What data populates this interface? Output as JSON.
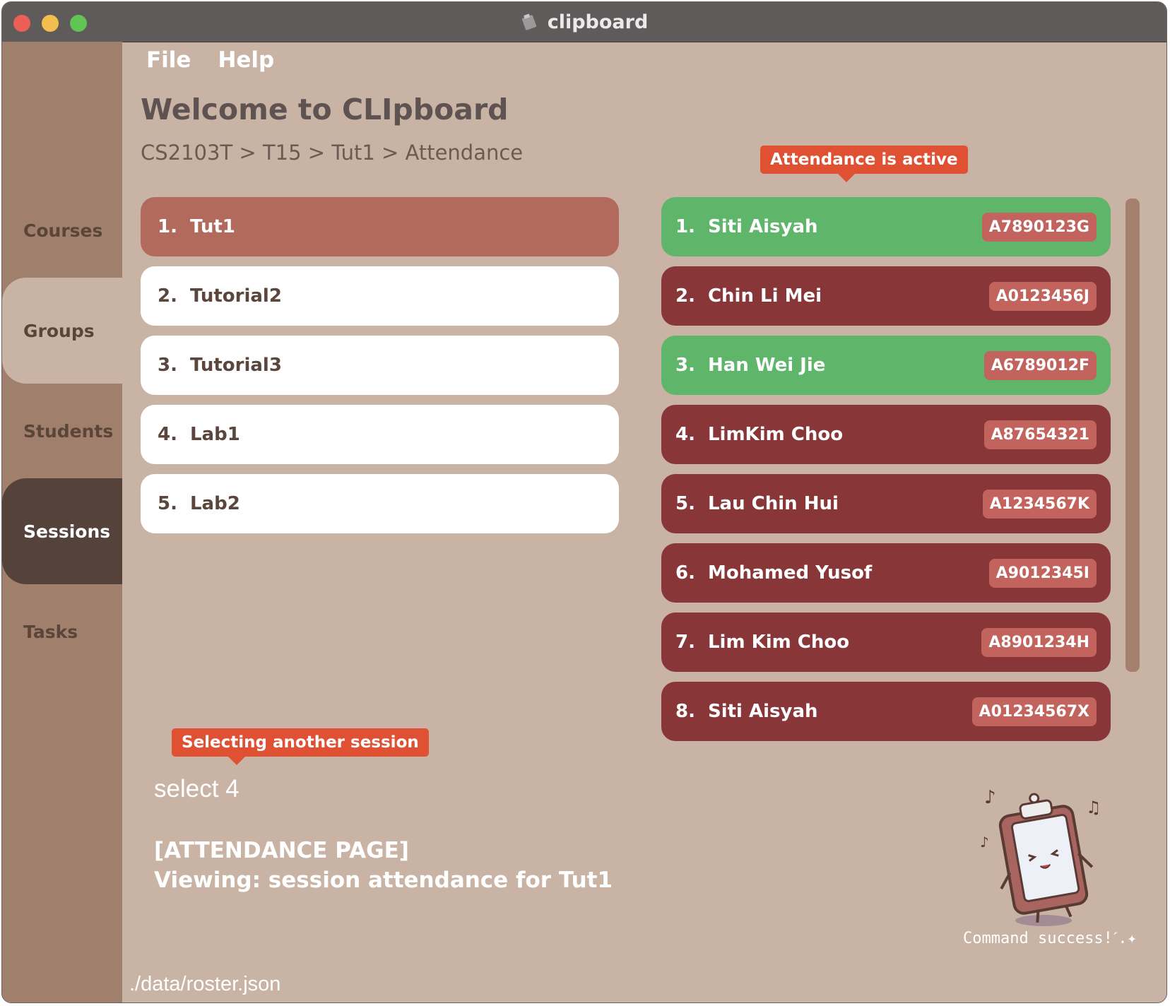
{
  "window": {
    "title": "clipboard",
    "title_icon": "clipboard-icon"
  },
  "menu": {
    "file": "File",
    "help": "Help"
  },
  "sidebar": {
    "items": [
      {
        "label": "Courses"
      },
      {
        "label": "Groups"
      },
      {
        "label": "Students"
      },
      {
        "label": "Sessions"
      },
      {
        "label": "Tasks"
      }
    ],
    "active": "Sessions"
  },
  "header": {
    "title": "Welcome to CLIpboard",
    "breadcrumb": "CS2103T > T15 > Tut1 > Attendance"
  },
  "callouts": {
    "attendance": "Attendance is active",
    "selecting": "Selecting another session"
  },
  "sessions": [
    {
      "index": "1.",
      "name": "Tut1",
      "active": true
    },
    {
      "index": "2.",
      "name": "Tutorial2"
    },
    {
      "index": "3.",
      "name": "Tutorial3"
    },
    {
      "index": "4.",
      "name": "Lab1"
    },
    {
      "index": "5.",
      "name": "Lab2"
    }
  ],
  "students": [
    {
      "index": "1.",
      "name": "Siti Aisyah",
      "id": "A7890123G",
      "present": true
    },
    {
      "index": "2.",
      "name": "Chin Li Mei",
      "id": "A0123456J",
      "present": false
    },
    {
      "index": "3.",
      "name": "Han Wei Jie",
      "id": "A6789012F",
      "present": true
    },
    {
      "index": "4.",
      "name": "LimKim Choo",
      "id": "A87654321",
      "present": false
    },
    {
      "index": "5.",
      "name": "Lau Chin Hui",
      "id": "A1234567K",
      "present": false
    },
    {
      "index": "6.",
      "name": "Mohamed Yusof",
      "id": "A9012345I",
      "present": false
    },
    {
      "index": "7.",
      "name": "Lim Kim Choo",
      "id": "A8901234H",
      "present": false
    },
    {
      "index": "8.",
      "name": "Siti Aisyah",
      "id": "A01234567X",
      "present": false
    }
  ],
  "command": {
    "input": "select 4",
    "result_line1": "[ATTENDANCE PAGE]",
    "result_line2": "Viewing: session attendance for Tut1"
  },
  "status": {
    "path": "./data/roster.json"
  },
  "mascot": {
    "caption": "Command success!",
    "caption_suffix": "ˊ.✦"
  },
  "colors": {
    "present": "#5fb56a",
    "absent": "#883638",
    "selected_session": "#b26a5d",
    "callout": "#e05032"
  }
}
